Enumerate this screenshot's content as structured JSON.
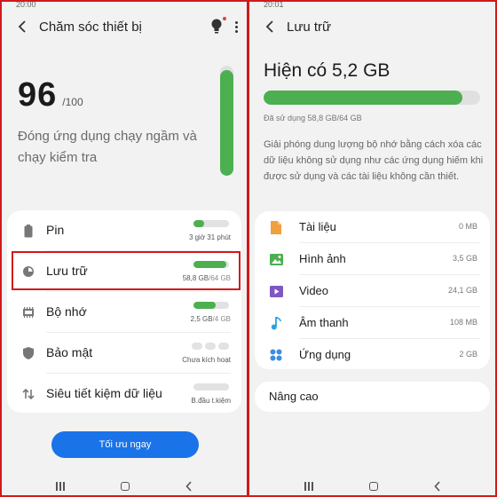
{
  "left": {
    "status_time": "20:00",
    "title": "Chăm sóc thiết bị",
    "score": {
      "value": "96",
      "max": "/100",
      "description": "Đóng ứng dụng chạy ngầm và chạy kiểm tra",
      "level": 0.96
    },
    "items": [
      {
        "label": "Pin",
        "value": "3 giờ 31 phút",
        "value_muted": "",
        "level": 0.3,
        "icon": "battery-icon"
      },
      {
        "label": "Lưu trữ",
        "value": "58,8 GB",
        "value_muted": "/64 GB",
        "level": 0.92,
        "icon": "pie-chart-icon"
      },
      {
        "label": "Bộ nhớ",
        "value": "2,5 GB",
        "value_muted": "/4 GB",
        "level": 0.62,
        "icon": "memory-chip-icon"
      },
      {
        "label": "Bảo mật",
        "value": "Chưa kích hoạt",
        "value_muted": "",
        "icon": "shield-icon"
      },
      {
        "label": "Siêu tiết kiệm dữ liệu",
        "value": "B.đầu t.kiệm",
        "value_muted": "",
        "level": 0.0,
        "icon": "data-saver-icon"
      }
    ],
    "button_label": "Tối ưu ngay"
  },
  "right": {
    "status_time": "20:01",
    "title": "Lưu trữ",
    "available": "Hiện có 5,2 GB",
    "used_text": "Đã sử dụng 58,8 GB/64 GB",
    "used_level": 0.92,
    "description": "Giải phóng dung lượng bộ nhớ bằng cách xóa các dữ liệu không sử dụng như các ứng dụng hiếm khi được sử dụng và các tài liệu không cần thiết.",
    "items": [
      {
        "label": "Tài liệu",
        "value": "0 MB",
        "icon": "document-icon",
        "color": "#f2a03d"
      },
      {
        "label": "Hình ảnh",
        "value": "3,5 GB",
        "icon": "image-icon",
        "color": "#4caf50"
      },
      {
        "label": "Video",
        "value": "24,1 GB",
        "icon": "video-icon",
        "color": "#7e57c2"
      },
      {
        "label": "Âm thanh",
        "value": "108 MB",
        "icon": "music-note-icon",
        "color": "#29a3e0"
      },
      {
        "label": "Ứng dụng",
        "value": "2 GB",
        "icon": "apps-icon",
        "color": "#3b8de0"
      }
    ],
    "advanced_label": "Nâng cao"
  },
  "colors": {
    "accent_green": "#4caf50",
    "button_blue": "#1a73e8",
    "highlight_red": "#d0191d"
  }
}
